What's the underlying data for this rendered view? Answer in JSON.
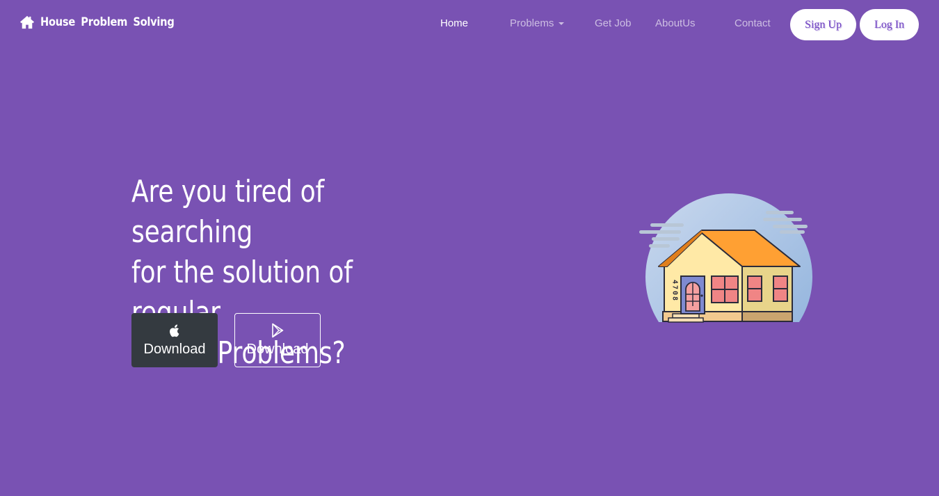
{
  "navbar": {
    "brand_text": "House  Problem  Solving",
    "brand_icon": "home-icon",
    "links": [
      {
        "label": "Home",
        "active": true
      },
      {
        "label": "Problems",
        "dropdown": true
      },
      {
        "label": "Get Job"
      },
      {
        "label": "AboutUs"
      },
      {
        "label": "Contact"
      }
    ],
    "signup_label": "Sign Up",
    "login_label": "Log In"
  },
  "hero": {
    "heading_lines": [
      "Are you tired of searching",
      "for the solution of regular",
      "House Problems?"
    ],
    "download_apple": {
      "label": "Download",
      "icon": "apple-icon"
    },
    "download_play": {
      "label": "Download",
      "icon": "google-play-icon"
    },
    "house_number": "4708"
  },
  "colors": {
    "background": "#7952b3",
    "dark_button": "#343a40",
    "accent_text": "#6f42c1",
    "roof": "#ffa033",
    "house_wall": "#ffe9a6"
  }
}
